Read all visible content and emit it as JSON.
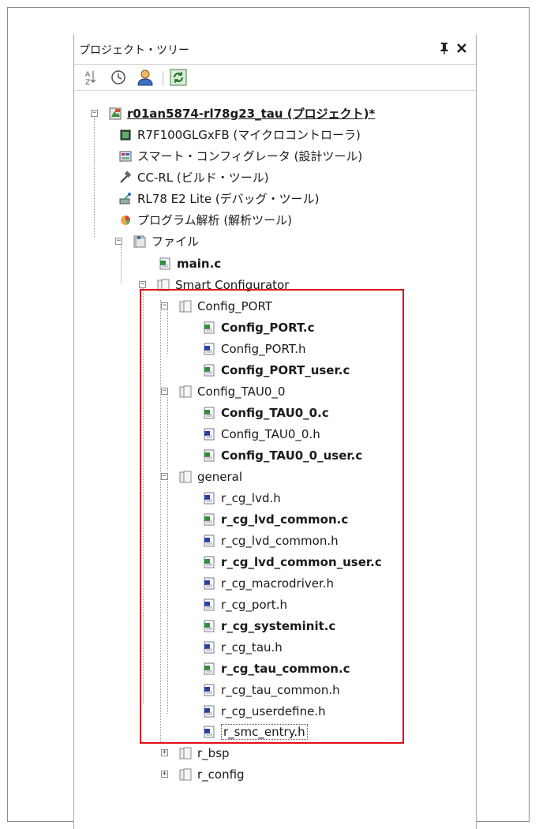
{
  "panel": {
    "title": "プロジェクト・ツリー",
    "pin_glyph": "ᵽ",
    "close_glyph": "✕"
  },
  "toolbar": {
    "icons": [
      "sort-az-icon",
      "clock-icon",
      "user-icon",
      "refresh-icon"
    ]
  },
  "tree": {
    "project": "r01an5874-rl78g23_tau (プロジェクト)*",
    "mcu": "R7F100GLGxFB (マイクロコントローラ)",
    "smart_config_tool": "スマート・コンフィグレータ (設計ツール)",
    "build_tool": "CC-RL (ビルド・ツール)",
    "debug_tool": "RL78 E2 Lite (デバッグ・ツール)",
    "analysis_tool": "プログラム解析 (解析ツール)",
    "files_folder": "ファイル",
    "main_c": "main.c",
    "smart_configurator": "Smart Configurator",
    "config_port": "Config_PORT",
    "config_port_files": [
      "Config_PORT.c",
      "Config_PORT.h",
      "Config_PORT_user.c"
    ],
    "config_tau": "Config_TAU0_0",
    "config_tau_files": [
      "Config_TAU0_0.c",
      "Config_TAU0_0.h",
      "Config_TAU0_0_user.c"
    ],
    "general": "general",
    "general_files": [
      "r_cg_lvd.h",
      "r_cg_lvd_common.c",
      "r_cg_lvd_common.h",
      "r_cg_lvd_common_user.c",
      "r_cg_macrodriver.h",
      "r_cg_port.h",
      "r_cg_systeminit.c",
      "r_cg_tau.h",
      "r_cg_tau_common.c",
      "r_cg_tau_common.h",
      "r_cg_userdefine.h",
      "r_smc_entry.h"
    ],
    "r_bsp": "r_bsp",
    "r_config": "r_config"
  },
  "colors": {
    "highlight": "#e0101a",
    "c_file": "#2f8f3a",
    "h_file": "#2a3fa8"
  }
}
